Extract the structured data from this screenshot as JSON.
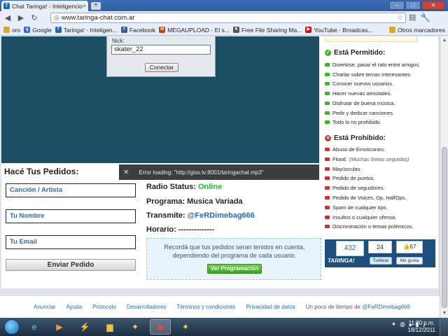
{
  "browser": {
    "tab_title": "Chat Taringa! - Inteligencio",
    "tab_close": "×",
    "new_tab": "+",
    "url": "www.taringa-chat.com.ar",
    "bookmarks": [
      {
        "label": "oro",
        "color": "#555555"
      },
      {
        "label": "Google",
        "color": "#3366cc"
      },
      {
        "label": "Taringa! - Inteligen...",
        "color": "#1f66b0"
      },
      {
        "label": "Facebook",
        "color": "#3b5998"
      },
      {
        "label": "MEGAUPLOAD - El s...",
        "color": "#b8401c"
      },
      {
        "label": "Free File Sharing Ma...",
        "color": "#555555"
      },
      {
        "label": "YouTube - Broadcas...",
        "color": "#cc1111"
      }
    ],
    "other_bookmarks": "Otros marcadores"
  },
  "chat": {
    "nick_label": "Nick:",
    "nick_value": "skater_22",
    "connect_button": "Conectar"
  },
  "pedidos": {
    "title": "Hacé Tus Pedidos:",
    "song_placeholder": "Canción / Artista",
    "name_placeholder": "Tu Nombre",
    "email_placeholder": "Tu Email",
    "send_button": "Enviar Pedido"
  },
  "radio": {
    "status_label": "Radio Status:",
    "status_value": "Online",
    "program_label": "Programa:",
    "program_value": "Musica Variada",
    "transmite_label": "Transmite:",
    "transmite_value": "@FeRDimebag666",
    "horario_label": "Horario:",
    "horario_value": "--------------",
    "notice": "Recordá que tus pedidos seran tenidos en cuenta, dependiendo del programa de cada usuario.",
    "schedule_button": "Ver Programación"
  },
  "error": {
    "text": "Error loading: \"http://giss.tv:8001/taringachat.mp3\""
  },
  "rules": {
    "allowed_title": "Está Permitido:",
    "allowed": [
      "Divertirse, pasar el rato entre amigos.",
      "Charlar sobre temas interesantes.",
      "Conocer nuevos usuarios.",
      "Hacer nuevas amistades.",
      "Disfrutar de buena música.",
      "Pedir y dedicar canciones.",
      "Todo lo no prohibido."
    ],
    "forbidden_title": "Está Prohibido:",
    "forbidden": [
      "Abuso de Emoticones.",
      "Flood.",
      "Mayúsculas",
      "Pedido de puntos.",
      "Pedido de seguidores.",
      "Pedido de Voices, Op, HalfOps.",
      "Spam de cualquier tipo.",
      "Insultos o cualquier ofensa.",
      "Discriminación o temas polémicos."
    ],
    "flood_note": "(Muchas líneas seguidas)",
    "allowed_color": "#3db52a",
    "forbidden_color": "#c8333a"
  },
  "social": {
    "taringa_count": "432",
    "twitter_count": "24",
    "like_count": "67",
    "taringa_logo": "TARINGA!",
    "twitter_button": "Twittear",
    "like_button": "Me gusta"
  },
  "footer": {
    "links": [
      "Anunciar",
      "Ayuda",
      "Protocolo",
      "Desarrolladores",
      "Términos y condiciones",
      "Privacidad de datos"
    ],
    "tagline_prefix": "Un poco de tiempo de",
    "tagline_handle": "@FeRDimebag666"
  },
  "taskbar": {
    "time": "11:20 p.m.",
    "date": "18/12/2011"
  }
}
